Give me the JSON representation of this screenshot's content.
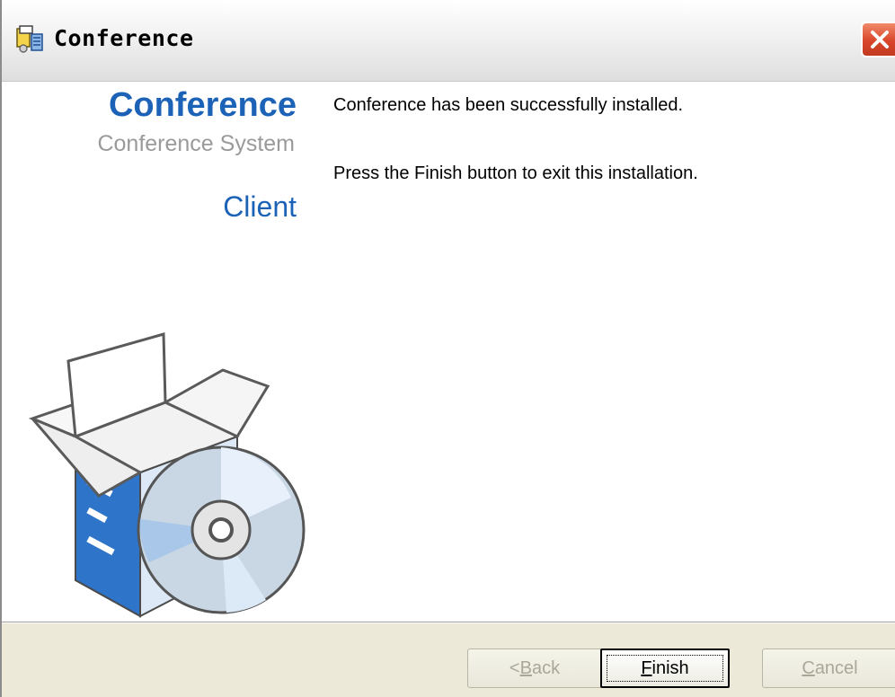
{
  "window": {
    "title": "Conference",
    "icon": "setup-icon",
    "close_icon": "close-icon",
    "close_color": "#d8452a"
  },
  "branding": {
    "product_name": "Conference",
    "product_subtitle": "Conference System",
    "edition": "Client",
    "accent_color": "#1c63b7",
    "artwork": "software-box-with-cd-icon"
  },
  "messages": {
    "line1": "Conference has been successfully installed.",
    "line2": "Press the Finish button to exit this installation."
  },
  "buttons": {
    "back": {
      "prefix": "< ",
      "mnemonic": "B",
      "rest": "ack",
      "enabled": false
    },
    "finish": {
      "mnemonic": "F",
      "rest": "inish",
      "enabled": true,
      "focused": true
    },
    "cancel": {
      "mnemonic": "C",
      "rest": "ancel",
      "enabled": false
    }
  }
}
